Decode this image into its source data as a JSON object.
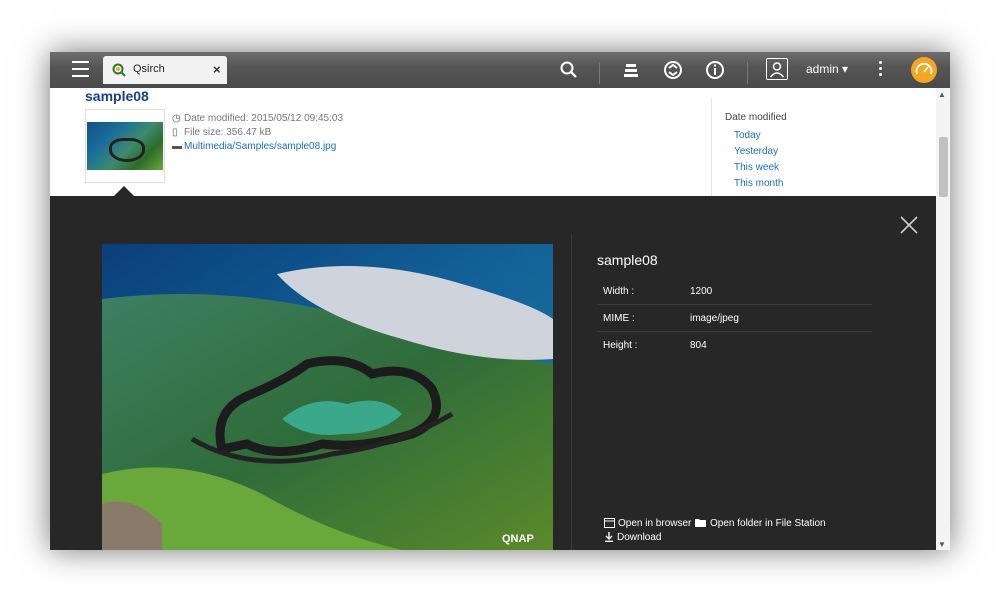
{
  "topbar": {
    "tab_label": "Qsirch",
    "tab_close": "×",
    "user_name": "admin ▾"
  },
  "result": {
    "title": "sample08",
    "date_modified": "Date modified: 2015/05/12 09:45:03",
    "file_size": "File size: 356.47 kB",
    "path": "Multimedia/Samples/sample08.jpg"
  },
  "filter": {
    "heading": "Date modified",
    "items": [
      "Today",
      "Yesterday",
      "This week",
      "This month"
    ]
  },
  "preview": {
    "title": "sample08",
    "details": [
      {
        "key": "Width :",
        "value": "1200"
      },
      {
        "key": "MIME :",
        "value": "image/jpeg"
      },
      {
        "key": "Height :",
        "value": "804"
      }
    ],
    "watermark": "QNAP",
    "actions": {
      "open_browser": "Open in browser",
      "open_folder": "Open folder in File Station",
      "download": "Download"
    }
  },
  "colors": {
    "accent_link": "#1a6fc2",
    "title_blue": "#1a3f8a",
    "panel_bg": "#272727",
    "speed_icon": "#f5a623"
  }
}
